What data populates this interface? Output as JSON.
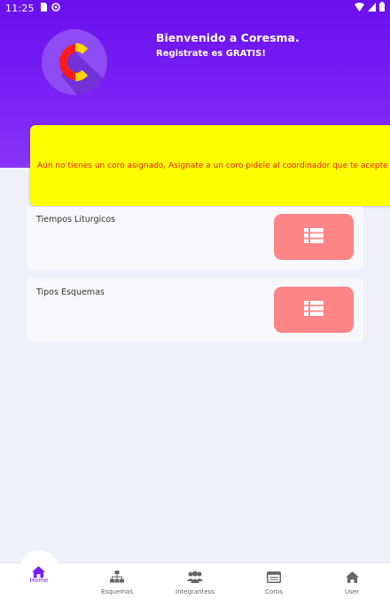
{
  "status_bar": {
    "time": "11:25",
    "left_icons": [
      "sim-card-icon",
      "sync-icon"
    ],
    "right_icons": [
      "wifi-icon",
      "signal-icon",
      "battery-icon"
    ]
  },
  "header": {
    "logo_letter": "C",
    "welcome": "Bienvenido a Coresma.",
    "subtitle": "Registrate es GRATIS!"
  },
  "warning": {
    "message": "Aún no tienes un coro asignado, Asignate a un coro pidele al coordinador que te acepte"
  },
  "cards": [
    {
      "label": "Tiempos Liturgicos",
      "button_icon": "list-icon"
    },
    {
      "label": "Tipos Esquemas",
      "button_icon": "list-icon"
    }
  ],
  "bottom_nav": {
    "items": [
      {
        "label": "Home",
        "icon": "home-icon",
        "active": true
      },
      {
        "label": "Esquemas",
        "icon": "hierarchy-icon"
      },
      {
        "label": "Integrantess",
        "icon": "group-icon"
      },
      {
        "label": "Coros",
        "icon": "window-icon"
      },
      {
        "label": "User",
        "icon": "home-icon"
      }
    ]
  },
  "colors": {
    "header": "#6a0fee",
    "warning_bg": "#ffff00",
    "warning_text": "#e0201c",
    "card_button": "#ff8587",
    "active_nav": "#7a1ff4"
  }
}
